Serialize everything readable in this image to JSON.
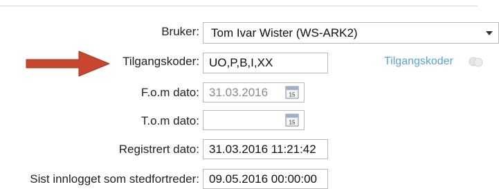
{
  "form": {
    "user_label": "Bruker:",
    "user_value": "Tom Ivar Wister (WS-ARK2)",
    "access_codes_label": "Tilgangskoder:",
    "access_codes_value": "UO,P,B,I,XX",
    "access_codes_link": "Tilgangskoder",
    "from_date_label": "F.o.m dato:",
    "from_date_value": "31.03.2016",
    "to_date_label": "T.o.m dato:",
    "to_date_value": "",
    "registered_label": "Registrert dato:",
    "registered_value": "31.03.2016 11:21:42",
    "last_login_label": "Sist innlogget som stedfortreder:",
    "last_login_value": "09.05.2016 00:00:00"
  },
  "icons": {
    "calendar_day": "15",
    "arrow_color": "#c8462e",
    "link_color": "#5aa3d9"
  }
}
